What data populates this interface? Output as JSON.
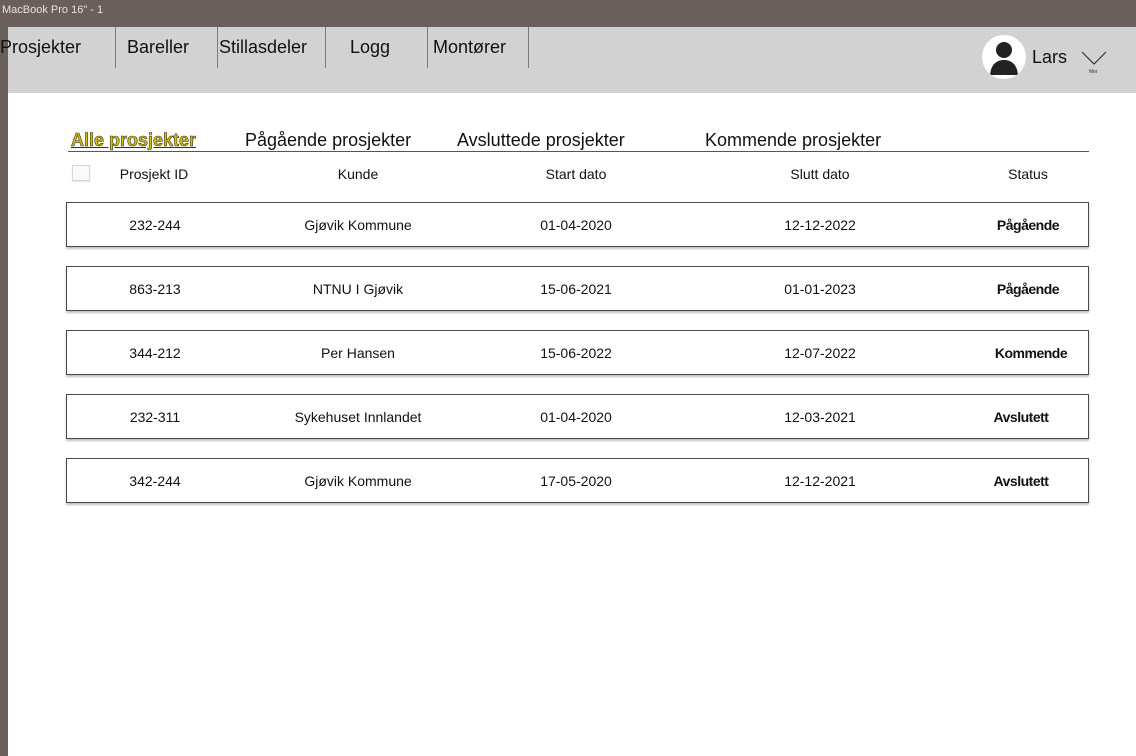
{
  "window": {
    "frame_title": "MacBook Pro 16\" - 1"
  },
  "nav": {
    "items": [
      "Prosjekter",
      "Bareller",
      "Stillasdeler",
      "Logg",
      "Montører"
    ]
  },
  "user": {
    "name": "Lars",
    "menu_caption": "Mer"
  },
  "tabs": [
    "Alle prosjekter",
    "Pågående prosjekter",
    "Avsluttede prosjekter",
    "Kommende prosjekter"
  ],
  "table": {
    "headers": [
      "Prosjekt ID",
      "Kunde",
      "Start dato",
      "Slutt dato",
      "Status"
    ],
    "rows": [
      [
        "232-244",
        "Gjøvik Kommune",
        "01-04-2020",
        "12-12-2022",
        "Pågående"
      ],
      [
        "863-213",
        "NTNU I Gjøvik",
        "15-06-2021",
        "01-01-2023",
        "Pågående"
      ],
      [
        "344-212",
        "Per Hansen",
        "15-06-2022",
        "12-07-2022",
        "Kommende"
      ],
      [
        "232-311",
        "Sykehuset Innlandet",
        "01-04-2020",
        "12-03-2021",
        "Avslutett"
      ],
      [
        "342-244",
        "Gjøvik Kommune",
        "17-05-2020",
        "12-12-2021",
        "Avslutett"
      ]
    ]
  },
  "colors": {
    "frame": "#6b5f5c",
    "topbar": "#d2d2d2",
    "active_tab": "#d8c200"
  }
}
